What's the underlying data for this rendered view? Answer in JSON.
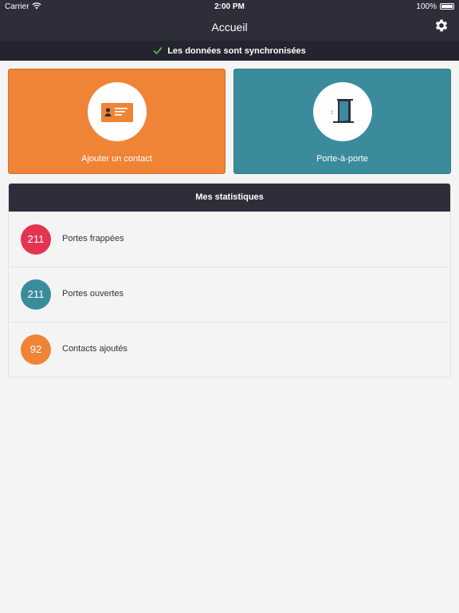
{
  "statusbar": {
    "carrier": "Carrier",
    "time": "2:00 PM",
    "battery": "100%"
  },
  "nav": {
    "title": "Accueil"
  },
  "sync": {
    "message": "Les données sont synchronisées"
  },
  "tiles": [
    {
      "label": "Ajouter un contact",
      "color": "#ef8437"
    },
    {
      "label": "Porte-à-porte",
      "color": "#3a8c9d"
    }
  ],
  "stats": {
    "title": "Mes statistiques",
    "items": [
      {
        "value": "211",
        "label": "Portes frappées",
        "color": "#e33452"
      },
      {
        "value": "211",
        "label": "Portes ouvertes",
        "color": "#3a8c9d"
      },
      {
        "value": "92",
        "label": "Contacts ajoutés",
        "color": "#ef8437"
      }
    ]
  }
}
